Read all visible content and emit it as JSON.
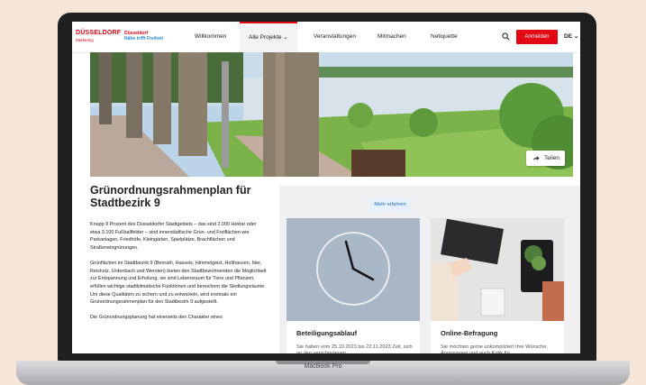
{
  "header": {
    "logo_main": "DÜSSELDORF",
    "logo_sub": "Marketing",
    "slogan_line1": "Düsseldorf",
    "slogan_line2": "Nähe trifft Freiheit",
    "nav": [
      {
        "label": "Willkommen"
      },
      {
        "label": "Alle Projekte ⌄"
      },
      {
        "label": "Veranstaltungen"
      },
      {
        "label": "Mitmachen"
      },
      {
        "label": "Netiquette"
      }
    ],
    "login_label": "Anmelden",
    "language": "DE ⌄"
  },
  "hero": {
    "share_label": "Teilen"
  },
  "article": {
    "title": "Grünordnungsrahmenplan für Stadtbezirk 9",
    "paragraphs": [
      "Knapp 9 Prozent des Düsseldorfer Stadtgebiets – das sind 2.000 Hektar oder etwa 3.100 Fußballfelder – sind innerstädtische Grün- und Freiflächen wie Parkanlagen, Friedhöfe, Kleingärten, Spielplätze, Brachflächen und Straßeneingrünungen.",
      "Grünflächen im Stadtbezirk 9 (Benrath, Hassels, Himmelgeist, Holthausen, Itter, Reisholz, Urdenbach und Wersten) bieten den Stadtbewohnenden die Möglichkeit zur Entspannung und Erholung, sie sind Lebensraum für Tiere und Pflanzen, erfüllen wichtige stadtklimatische Funktionen und bereichern die Siedlungsräume. Um diese Qualitäten zu sichern und zu entwickeln, wird erstmals ein Grünordnungsrahmenplan für den Stadtbezirk 9 aufgestellt.",
      "Die Grünordnungsplanung hat einerseits den Charakter eines"
    ]
  },
  "cards": {
    "more_label": "Mehr erfahren",
    "items": [
      {
        "title": "Beteiligungsablauf",
        "desc": "Sie haben vom 25.10.2023 bis 22.11.2023 Zeit, sich an den verschiedenen"
      },
      {
        "title": "Online-Befragung",
        "desc": "Sie möchten gerne unkompliziert Ihre Wünsche, Anregungen und auch Kritik für"
      }
    ]
  },
  "device": {
    "brand": "MacBook Pro"
  },
  "colors": {
    "accent": "#e30613",
    "link": "#1f6fb5",
    "background": "#f6e6da"
  }
}
